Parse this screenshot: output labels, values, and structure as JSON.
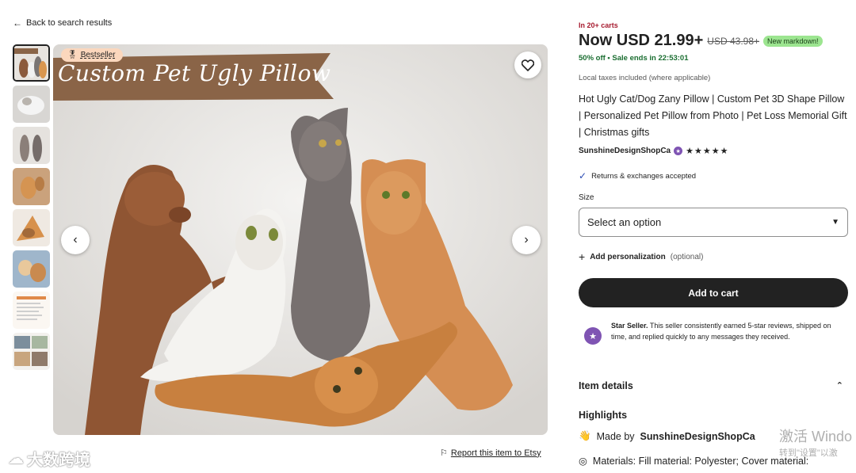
{
  "nav": {
    "back_label": "Back to search results"
  },
  "gallery": {
    "badge_label": "Bestseller",
    "banner_text": "Custom Pet Ugly Pillow",
    "thumb_count": 8
  },
  "report_label": "Report this item to Etsy",
  "watermark_logo": "大数跨境",
  "product": {
    "carts": "In 20+ carts",
    "price": "Now USD 21.99+",
    "old_price": "USD 43.98+",
    "markdown_badge": "New markdown!",
    "sale_text": "50% off • Sale ends in 22:53:01",
    "taxes": "Local taxes included (where applicable)",
    "title": "Hot Ugly Cat/Dog Zany Pillow | Custom Pet 3D Shape Pillow | Personalized Pet Pillow from Photo | Pet Loss Memorial Gift | Christmas gifts",
    "shop_name": "SunshineDesignShopCa",
    "stars": "★★★★★",
    "returns": "Returns & exchanges accepted",
    "size_label": "Size",
    "size_select": "Select an option",
    "personalization": "Add personalization",
    "personalization_optional": "(optional)",
    "add_to_cart": "Add to cart",
    "star_seller_title": "Star Seller.",
    "star_seller_text": "This seller consistently earned 5-star reviews, shipped on time, and replied quickly to any messages they received.",
    "item_details": "Item details",
    "highlights": "Highlights",
    "made_by_prefix": "Made by",
    "made_by_shop": "SunshineDesignShopCa",
    "materials": "Materials: Fill material: Polyester; Cover material:"
  },
  "os_overlay": {
    "activate": "激活 Windo",
    "activate_sub": "转到\"设置\"以激"
  },
  "colors": {
    "accent_dark": "#222222",
    "sale_green": "#1b6e31",
    "carts_red": "#a61a2e",
    "markdown_bg": "#9ce590",
    "star_seller_purple": "#7f54b3",
    "bestseller_bg": "#fbd7bd",
    "banner_brown": "#8a6447"
  }
}
